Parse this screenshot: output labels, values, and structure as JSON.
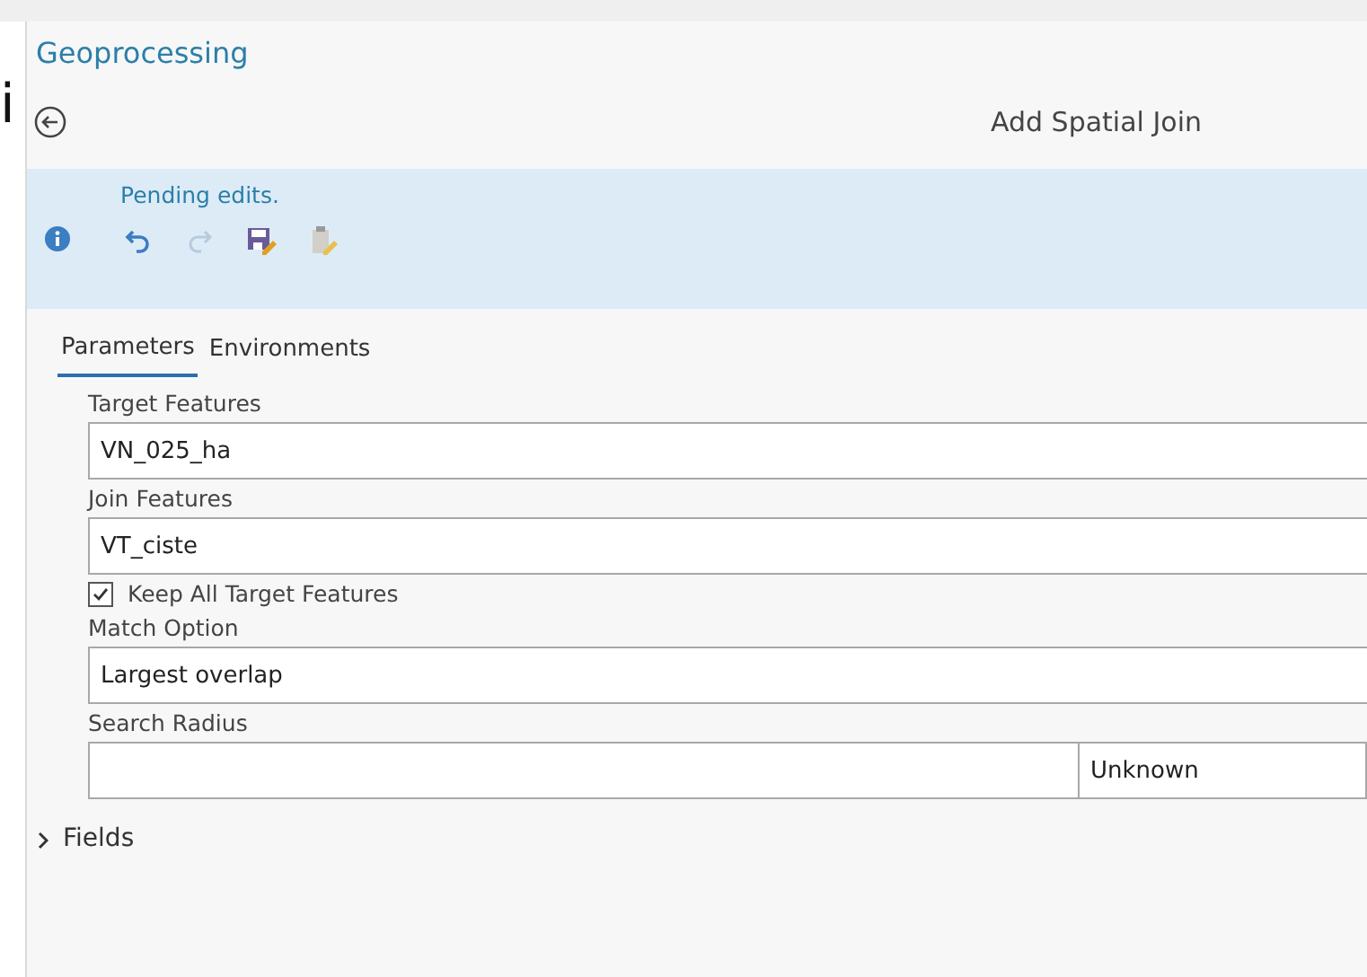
{
  "edge_text": "i",
  "pane_title": "Geoprocessing",
  "tool_title": "Add Spatial Join",
  "message": {
    "text": "Pending edits.",
    "tools": [
      {
        "kind": "undo",
        "disabled": false
      },
      {
        "kind": "redo",
        "disabled": true
      },
      {
        "kind": "save",
        "disabled": false
      },
      {
        "kind": "discard",
        "disabled": true
      }
    ]
  },
  "tabs": [
    {
      "label": "Parameters",
      "selected": true
    },
    {
      "label": "Environments",
      "selected": false
    }
  ],
  "parameters": [
    {
      "kind": "text",
      "label": "Target Features",
      "value": "VN_025_ha"
    },
    {
      "kind": "text",
      "label": "Join Features",
      "value": "VT_ciste"
    },
    {
      "kind": "checkbox",
      "label": "Keep All Target Features",
      "checked": true
    },
    {
      "kind": "text",
      "label": "Match Option",
      "value": "Largest overlap"
    },
    {
      "kind": "linear",
      "label": "Search Radius",
      "unit": "Unknown"
    }
  ],
  "fields_section": {
    "label": "Fields",
    "expanded": false
  }
}
